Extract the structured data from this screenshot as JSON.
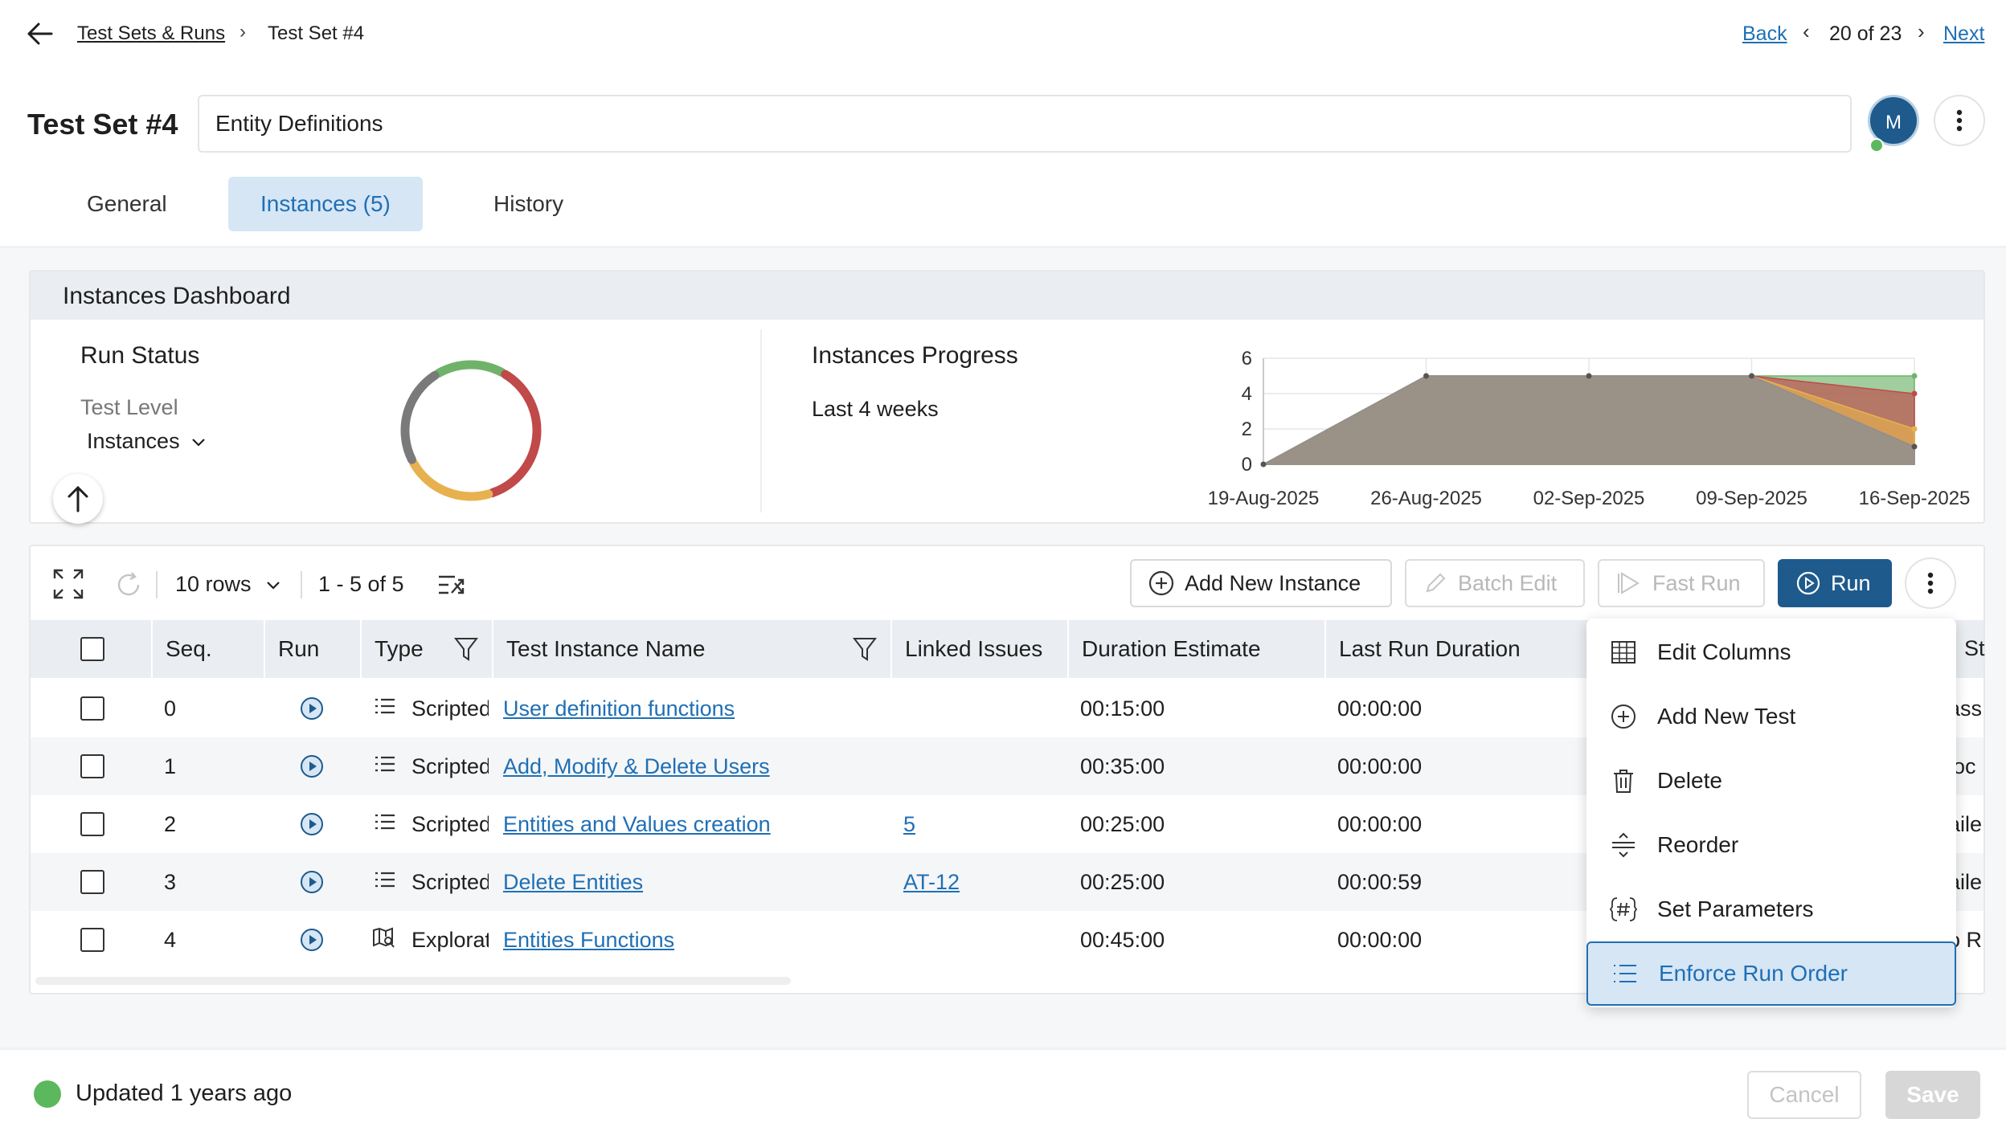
{
  "breadcrumb": {
    "parent": "Test Sets & Runs",
    "current": "Test Set #4"
  },
  "pager": {
    "back": "Back",
    "count": "20 of 23",
    "next": "Next"
  },
  "header": {
    "title": "Test Set #4",
    "name_value": "Entity Definitions",
    "avatar_initial": "M"
  },
  "tabs": [
    {
      "label": "General"
    },
    {
      "label": "Instances (5)"
    },
    {
      "label": "History"
    }
  ],
  "dashboard": {
    "title": "Instances Dashboard",
    "run_status": {
      "title": "Run Status",
      "level_label": "Test Level",
      "level_value": "Instances"
    },
    "progress": {
      "title": "Instances Progress",
      "subtitle": "Last 4 weeks"
    }
  },
  "chart_data": [
    {
      "type": "pie",
      "title": "Run Status",
      "variant": "donut",
      "labels": [],
      "values": [
        0.17,
        0.37,
        0.22,
        0.24
      ],
      "colors": [
        "#6fb36a",
        "#c0494a",
        "#e8b14f",
        "#7a7a7a"
      ]
    },
    {
      "type": "area",
      "title": "Instances Progress",
      "categories": [
        "19-Aug-2025",
        "26-Aug-2025",
        "02-Sep-2025",
        "09-Sep-2025",
        "16-Sep-2025"
      ],
      "ylim": [
        0,
        6
      ],
      "yticks": [
        0,
        2,
        4,
        6
      ],
      "grid": true,
      "series": [
        {
          "values": [
            0,
            5,
            5,
            5,
            1
          ],
          "color": "#8f8f8f"
        },
        {
          "values": [
            0,
            5,
            5,
            5,
            2
          ],
          "color": "#e8b14f"
        },
        {
          "values": [
            0,
            5,
            5,
            5,
            4
          ],
          "color": "#c0494a"
        },
        {
          "values": [
            0,
            5,
            5,
            5,
            5
          ],
          "color": "#6fb36a"
        }
      ]
    }
  ],
  "toolbar": {
    "rows": "10 rows",
    "range": "1 - 5 of 5",
    "add_instance": "Add New Instance",
    "batch_edit": "Batch Edit",
    "fast_run": "Fast Run",
    "run": "Run"
  },
  "table": {
    "headers": {
      "seq": "Seq.",
      "run": "Run",
      "type": "Type",
      "name": "Test Instance Name",
      "issues": "Linked Issues",
      "estimate": "Duration Estimate",
      "last": "Last Run Duration",
      "status": "St"
    },
    "rows": [
      {
        "seq": "0",
        "type": "Scripted",
        "name": "User definition functions",
        "issues": "",
        "estimate": "00:15:00",
        "last": "00:00:00",
        "status_peek": "ass"
      },
      {
        "seq": "1",
        "type": "Scripted",
        "name": "Add, Modify & Delete Users",
        "issues": "",
        "estimate": "00:35:00",
        "last": "00:00:00",
        "status_peek": "loc"
      },
      {
        "seq": "2",
        "type": "Scripted",
        "name": "Entities and Values creation",
        "issues": "5",
        "estimate": "00:25:00",
        "last": "00:00:00",
        "status_peek": "aile"
      },
      {
        "seq": "3",
        "type": "Scripted",
        "name": "Delete Entities",
        "issues": "AT-12",
        "estimate": "00:25:00",
        "last": "00:00:59",
        "status_peek": "aile"
      },
      {
        "seq": "4",
        "type": "Exploratory",
        "name": "Entities Functions",
        "issues": "",
        "estimate": "00:45:00",
        "last": "00:00:00",
        "status_peek": "o R"
      }
    ]
  },
  "menu": {
    "items": [
      {
        "label": "Edit Columns",
        "icon": "table-icon"
      },
      {
        "label": "Add New Test",
        "icon": "plus-circle-icon"
      },
      {
        "label": "Delete",
        "icon": "trash-icon"
      },
      {
        "label": "Reorder",
        "icon": "reorder-icon"
      },
      {
        "label": "Set Parameters",
        "icon": "hash-icon"
      },
      {
        "label": "Enforce Run Order",
        "icon": "ordered-list-icon"
      }
    ]
  },
  "footer": {
    "updated": "Updated 1 years ago",
    "cancel": "Cancel",
    "save": "Save"
  },
  "colors": {
    "accent": "#1e5a8c",
    "link": "#1f6fb5",
    "tab_active_bg": "#d6e6f5",
    "success": "#5cb85c"
  }
}
